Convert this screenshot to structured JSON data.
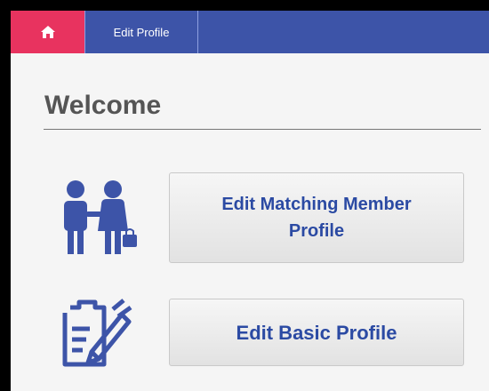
{
  "nav": {
    "home_icon": "home-icon",
    "tab_label": "Edit Profile"
  },
  "main": {
    "title": "Welcome",
    "buttons": [
      {
        "label": "Edit Matching Member Profile",
        "icon": "couple-icon"
      },
      {
        "label": "Edit Basic Profile",
        "icon": "clipboard-pen-icon"
      }
    ]
  },
  "colors": {
    "navbar": "#3d54a8",
    "home_tab": "#e8335f",
    "button_text": "#2b4aa3",
    "icon": "#3d54a8"
  }
}
